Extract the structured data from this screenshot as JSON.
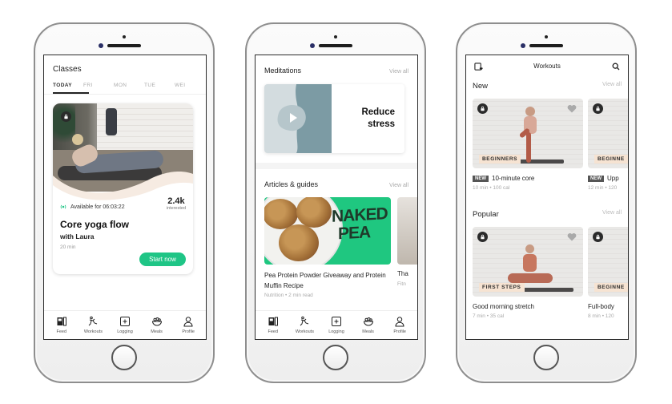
{
  "tab_bar": {
    "tabs": [
      {
        "icon": "feed-icon",
        "label": "Feed"
      },
      {
        "icon": "workouts-icon",
        "label": "Workouts"
      },
      {
        "icon": "logging-icon",
        "label": "Logging"
      },
      {
        "icon": "meals-icon",
        "label": "Meals"
      },
      {
        "icon": "profile-icon",
        "label": "Profile"
      }
    ]
  },
  "classes_screen": {
    "title": "Classes",
    "days": [
      "TODAY",
      "FRI",
      "MON",
      "TUE",
      "WEI"
    ],
    "active_day": "TODAY",
    "card": {
      "availability": "Available for 06:03:22",
      "interested_count": "2.4k",
      "interested_label": "interested",
      "title": "Core yoga flow",
      "instructor": "with Laura",
      "duration": "20 min",
      "cta": "Start now",
      "cta_color": "#1fc586"
    }
  },
  "feed_screen": {
    "meditations": {
      "title": "Meditations",
      "view_all": "View all",
      "card_line1": "Reduce",
      "card_line2": "stress"
    },
    "articles": {
      "title": "Articles & guides",
      "view_all": "View all",
      "items": [
        {
          "title": "Pea Protein Powder Giveaway and Protein Muffin Recipe",
          "meta": "Nutrition • 2 min read",
          "image_text_1": "NAKED",
          "image_text_2": "PEA"
        },
        {
          "title": "Tha",
          "meta": "Fitn"
        }
      ]
    }
  },
  "workouts_screen": {
    "title": "Workouts",
    "sections": [
      {
        "title": "New",
        "view_all": "View all",
        "items": [
          {
            "tag": "BEGINNERS",
            "badge": "NEW",
            "name": "10-minute core",
            "meta": "10 min • 100 cal"
          },
          {
            "tag": "BEGINNE",
            "badge": "NEW",
            "name": "Upp",
            "meta": "12 min • 120"
          }
        ]
      },
      {
        "title": "Popular",
        "view_all": "View all",
        "items": [
          {
            "tag": "FIRST STEPS",
            "name": "Good morning stretch",
            "meta": "7 min • 35 cal"
          },
          {
            "tag": "BEGINNE",
            "name": "Full-body",
            "meta": "8 min • 120"
          }
        ]
      }
    ]
  }
}
